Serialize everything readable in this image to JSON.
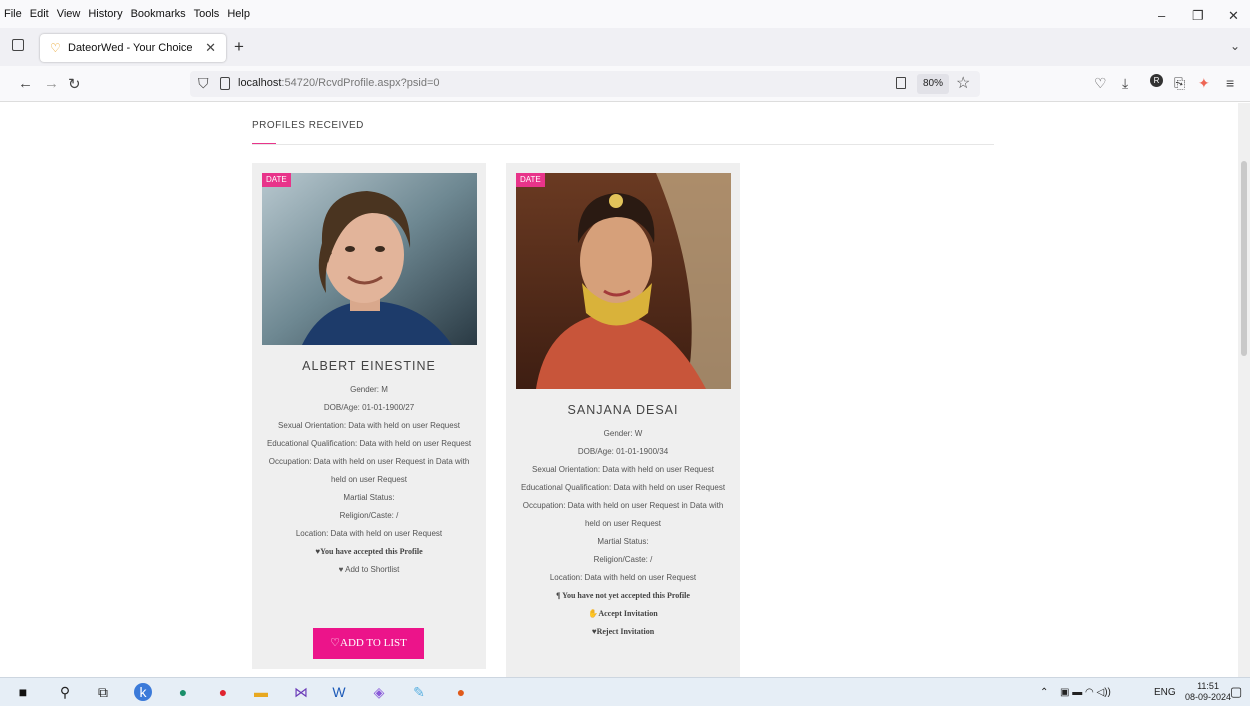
{
  "menubar": {
    "items": [
      "File",
      "Edit",
      "View",
      "History",
      "Bookmarks",
      "Tools",
      "Help"
    ]
  },
  "tab": {
    "title": "DateorWed - Your Choice"
  },
  "address": {
    "host": "localhost",
    "path": ":54720/RcvdProfile.aspx?psid=0",
    "zoom": "80%"
  },
  "page": {
    "heading": "PROFILES RECEIVED"
  },
  "profiles": [
    {
      "badge": "DATE",
      "name": "ALBERT EINESTINE",
      "gender": "Gender: M",
      "dob": "DOB/Age: 01-01-1900/27",
      "orientation": "Sexual Orientation: Data with held on user Request",
      "education": "Educational Qualification: Data with held on user Request",
      "occupation": "Occupation: Data with held on user Request in Data with held on user Request",
      "marital": "Martial Status:",
      "religion": "Religion/Caste: /",
      "location": "Location: Data with held on user Request",
      "status": "♥You have accepted this Profile",
      "shortlist": "♥ Add to Shortlist",
      "button": "♡ADD TO LIST"
    },
    {
      "badge": "DATE",
      "name": "SANJANA DESAI",
      "gender": "Gender: W",
      "dob": "DOB/Age: 01-01-1900/34",
      "orientation": "Sexual Orientation: Data with held on user Request",
      "education": "Educational Qualification: Data with held on user Request",
      "occupation": "Occupation: Data with held on user Request in Data with held on user Request",
      "marital": "Martial Status:",
      "religion": "Religion/Caste: /",
      "location": "Location: Data with held on user Request",
      "status": "¶ You have not yet accepted this Profile",
      "accept": "Accept Invitation",
      "reject": "♥Reject Invitation"
    }
  ],
  "taskbar": {
    "lang": "ENG",
    "time": "11:51",
    "date": "08-09-2024"
  },
  "colors": {
    "accent": "#e8348a",
    "button": "#ec148a"
  }
}
